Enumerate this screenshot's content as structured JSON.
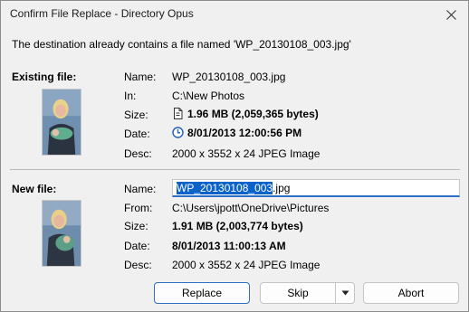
{
  "window": {
    "title": "Confirm File Replace - Directory Opus"
  },
  "message": "The destination already contains a file named 'WP_20130108_003.jpg'",
  "existing": {
    "heading": "Existing file:",
    "labels": {
      "name": "Name:",
      "in": "In:",
      "size": "Size:",
      "date": "Date:",
      "desc": "Desc:"
    },
    "name": "WP_20130108_003.jpg",
    "in": "C:\\New Photos",
    "size": "1.96 MB (2,059,365 bytes)",
    "date": "8/01/2013 12:00:56 PM",
    "desc": "2000 x 3552 x 24 JPEG Image",
    "size_icon": "document-icon",
    "date_icon": "clock-icon"
  },
  "new": {
    "heading": "New file:",
    "labels": {
      "name": "Name:",
      "from": "From:",
      "size": "Size:",
      "date": "Date:",
      "desc": "Desc:"
    },
    "name_selected": "WP_20130108_003",
    "name_rest": ".jpg",
    "from": "C:\\Users\\jpott\\OneDrive\\Pictures",
    "size": "1.91 MB (2,003,774 bytes)",
    "date": "8/01/2013 11:00:13 AM",
    "desc": "2000 x 3552 x 24 JPEG Image"
  },
  "buttons": {
    "replace": "Replace",
    "skip": "Skip",
    "abort": "Abort"
  },
  "colors": {
    "accent": "#2f6fc4",
    "selection": "#0b63c9"
  }
}
